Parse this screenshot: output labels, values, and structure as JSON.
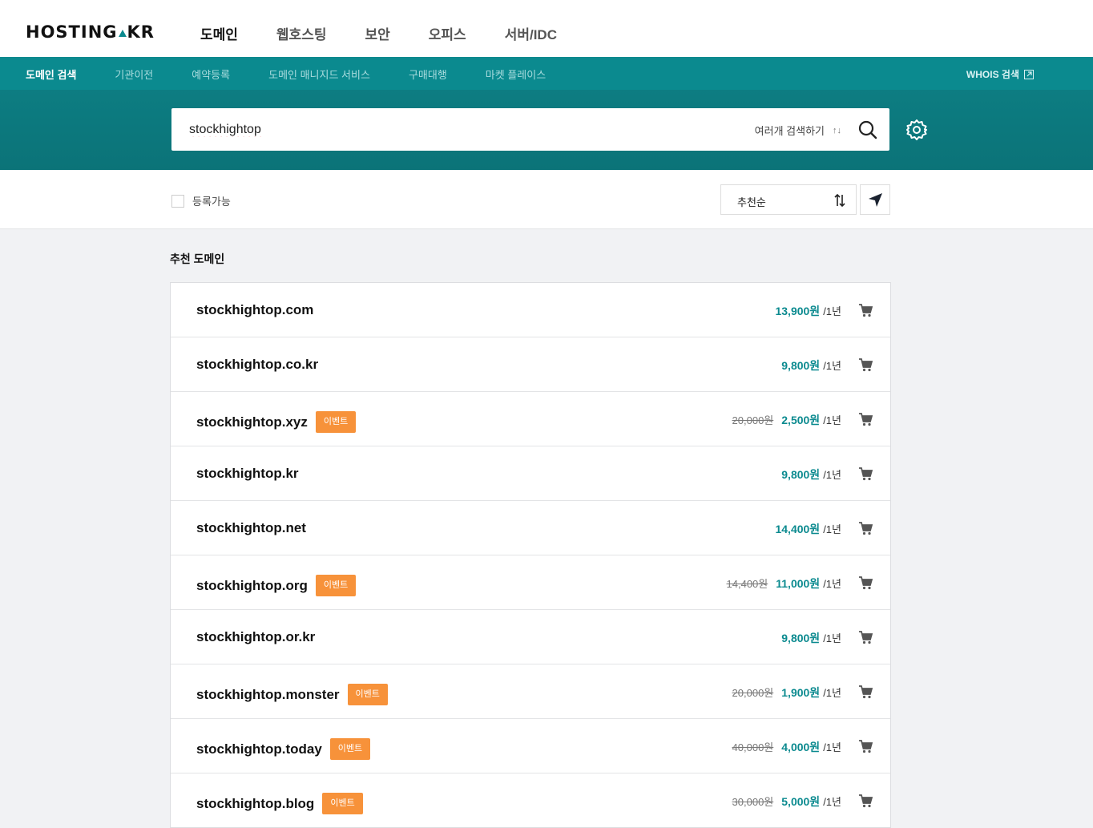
{
  "header": {
    "logo_left": "HOSTING",
    "logo_right": "KR",
    "nav": [
      "도메인",
      "웹호스팅",
      "보안",
      "오피스",
      "서버/IDC"
    ]
  },
  "subnav": {
    "items": [
      "도메인 검색",
      "기관이전",
      "예약등록",
      "도메인 매니지드 서비스",
      "구매대행",
      "마켓 플레이스"
    ],
    "whois": "WHOIS 검색"
  },
  "search": {
    "value": "stockhightop",
    "multi_label": "여러개 검색하기",
    "multi_toggle": "↑↓"
  },
  "filter": {
    "available_label": "등록가능",
    "sort_value": "추천순"
  },
  "section_title": "추천 도메인",
  "period": "/1년",
  "event_label": "이벤트",
  "results": [
    {
      "name": "stockhightop.com",
      "event": "",
      "old_price": "",
      "price": "13,900원"
    },
    {
      "name": "stockhightop.co.kr",
      "event": "",
      "old_price": "",
      "price": "9,800원"
    },
    {
      "name": "stockhightop.xyz",
      "event": "이벤트",
      "old_price": "20,000원",
      "price": "2,500원"
    },
    {
      "name": "stockhightop.kr",
      "event": "",
      "old_price": "",
      "price": "9,800원"
    },
    {
      "name": "stockhightop.net",
      "event": "",
      "old_price": "",
      "price": "14,400원"
    },
    {
      "name": "stockhightop.org",
      "event": "이벤트",
      "old_price": "14,400원",
      "price": "11,000원"
    },
    {
      "name": "stockhightop.or.kr",
      "event": "",
      "old_price": "",
      "price": "9,800원"
    },
    {
      "name": "stockhightop.monster",
      "event": "이벤트",
      "old_price": "20,000원",
      "price": "1,900원"
    },
    {
      "name": "stockhightop.today",
      "event": "이벤트",
      "old_price": "40,000원",
      "price": "4,000원"
    },
    {
      "name": "stockhightop.blog",
      "event": "이벤트",
      "old_price": "30,000원",
      "price": "5,000원"
    }
  ],
  "colors": {
    "accent": "#0b8a8f",
    "event": "#f7923a"
  }
}
